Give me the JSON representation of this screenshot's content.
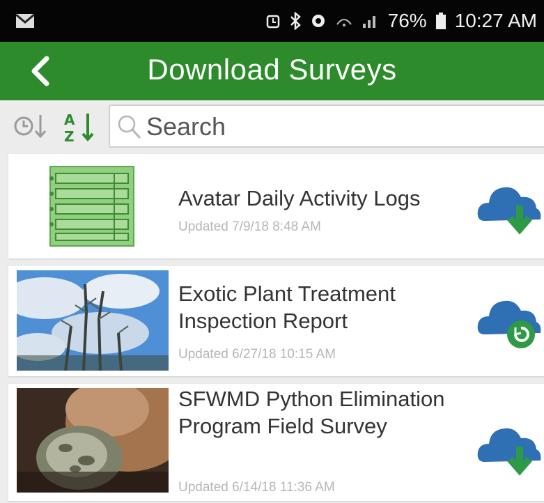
{
  "status_bar": {
    "battery_percent": "76%",
    "time": "10:27 AM"
  },
  "app_bar": {
    "title": "Download Surveys"
  },
  "toolbar": {
    "search_placeholder": "Search"
  },
  "surveys": [
    {
      "title": "Avatar Daily Activity Logs",
      "updated": "Updated 7/9/18 8:48 AM",
      "action_icon": "cloud-download-icon"
    },
    {
      "title": "Exotic Plant Treatment Inspection Report",
      "updated": "Updated 6/27/18 10:15 AM",
      "action_icon": "cloud-refresh-icon"
    },
    {
      "title": "SFWMD Python Elimination Program Field Survey",
      "updated": "Updated 6/14/18 11:36 AM",
      "action_icon": "cloud-download-icon"
    }
  ],
  "colors": {
    "app_bar": "#2e8b2c",
    "status_bar": "#050505",
    "cloud": "#2f6fb4",
    "action_green": "#2e9a45"
  }
}
